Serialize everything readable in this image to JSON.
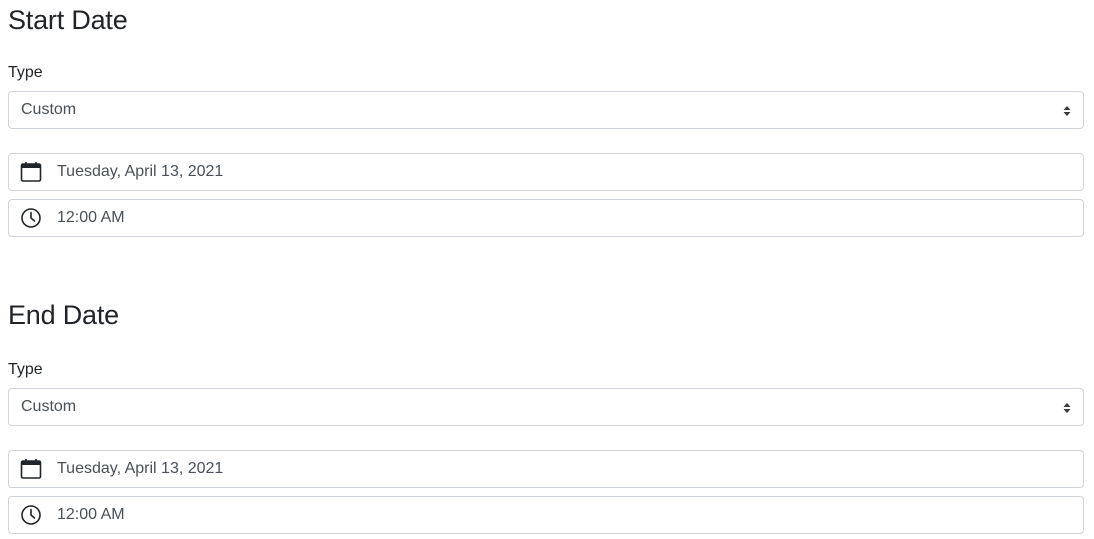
{
  "start": {
    "title": "Start Date",
    "type_label": "Type",
    "type_value": "Custom",
    "date_value": "Tuesday, April 13, 2021",
    "time_value": "12:00 AM"
  },
  "end": {
    "title": "End Date",
    "type_label": "Type",
    "type_value": "Custom",
    "date_value": "Tuesday, April 13, 2021",
    "time_value": "12:00 AM"
  },
  "icons": {
    "date": "calendar-icon",
    "time": "clock-icon",
    "select": "sort-arrows-icon"
  },
  "colors": {
    "text": "#212529",
    "input_text": "#495057",
    "border": "#ced4da"
  }
}
